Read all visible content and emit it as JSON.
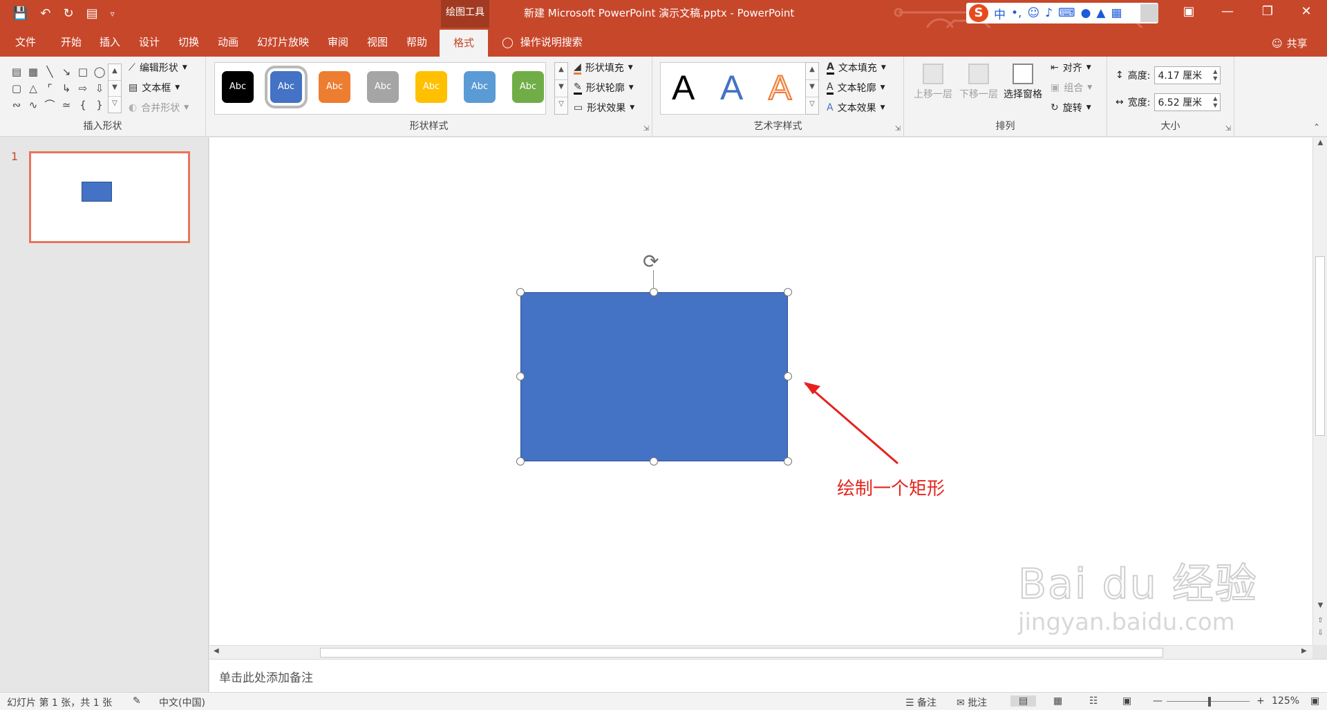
{
  "titlebar": {
    "tools_label": "绘图工具",
    "title": "新建 Microsoft PowerPoint 演示文稿.pptx  -  PowerPoint",
    "qat_icons": [
      "save-icon",
      "undo-icon",
      "redo-icon",
      "slideshow-start-icon",
      "customize-qat-icon"
    ],
    "ime_label": "中",
    "ime_punct": "•,",
    "accent": "#c7472b"
  },
  "tabs": [
    {
      "label": "文件"
    },
    {
      "label": "开始"
    },
    {
      "label": "插入"
    },
    {
      "label": "设计"
    },
    {
      "label": "切换"
    },
    {
      "label": "动画"
    },
    {
      "label": "幻灯片放映"
    },
    {
      "label": "审阅"
    },
    {
      "label": "视图"
    },
    {
      "label": "帮助"
    },
    {
      "label": "格式",
      "active": true
    }
  ],
  "tellme": "操作说明搜索",
  "share": "共享",
  "ribbon": {
    "insert_shapes": {
      "label": "插入形状",
      "edit_shape": "编辑形状",
      "text_box": "文本框",
      "merge_shapes": "合并形状"
    },
    "shape_styles": {
      "label": "形状样式",
      "swatches": [
        {
          "text": "Abc",
          "color": "#000000"
        },
        {
          "text": "Abc",
          "color": "#4472c4",
          "selected": true
        },
        {
          "text": "Abc",
          "color": "#ed7d31"
        },
        {
          "text": "Abc",
          "color": "#a5a5a5"
        },
        {
          "text": "Abc",
          "color": "#ffc000"
        },
        {
          "text": "Abc",
          "color": "#5b9bd5"
        },
        {
          "text": "Abc",
          "color": "#70ad47"
        }
      ],
      "fill": "形状填充",
      "outline": "形状轮廓",
      "effects": "形状效果"
    },
    "wordart": {
      "label": "艺术字样式",
      "letters": [
        "A",
        "A",
        "A"
      ],
      "text_fill": "文本填充",
      "text_outline": "文本轮廓",
      "text_effects": "文本效果"
    },
    "arrange": {
      "label": "排列",
      "bring_forward": "上移一层",
      "send_backward": "下移一层",
      "selection_pane": "选择窗格",
      "align": "对齐",
      "group": "组合",
      "rotate": "旋转"
    },
    "size": {
      "label": "大小",
      "height_label": "高度:",
      "height_value": "4.17 厘米",
      "width_label": "宽度:",
      "width_value": "6.52 厘米"
    }
  },
  "thumbnail": {
    "number": "1"
  },
  "slide": {
    "shape_color": "#4472c4",
    "annotation": "绘制一个矩形",
    "annotation_color": "#e5231c",
    "watermark": "Bai du 经验",
    "watermark_sub": "jingyan.baidu.com"
  },
  "notes": {
    "placeholder": "单击此处添加备注"
  },
  "status": {
    "slide_info": "幻灯片 第 1 张，共 1 张",
    "language": "中文(中国)",
    "notes": "备注",
    "comments": "批注",
    "zoom": "125%"
  }
}
